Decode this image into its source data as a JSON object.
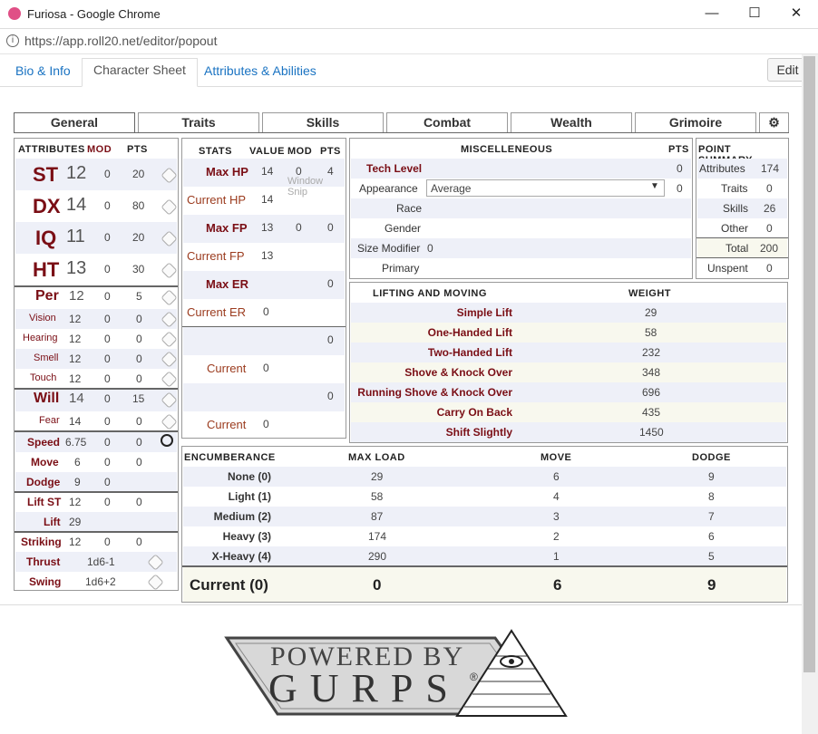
{
  "window": {
    "title": "Furiosa - Google Chrome",
    "minimize": "—",
    "maximize": "☐",
    "close": "✕"
  },
  "url": "https://app.roll20.net/editor/popout",
  "page_tabs": [
    {
      "label": "Bio & Info"
    },
    {
      "label": "Character Sheet"
    },
    {
      "label": "Attributes & Abilities"
    }
  ],
  "edit_label": "Edit",
  "sheet_tabs": [
    "General",
    "Traits",
    "Skills",
    "Combat",
    "Wealth",
    "Grimoire"
  ],
  "attributes": {
    "header": {
      "a": "ATTRIBUTES",
      "m": "MOD",
      "p": "PTS"
    },
    "main": [
      {
        "n": "ST",
        "v": "12",
        "m": "0",
        "p": "20"
      },
      {
        "n": "DX",
        "v": "14",
        "m": "0",
        "p": "80"
      },
      {
        "n": "IQ",
        "v": "11",
        "m": "0",
        "p": "20"
      },
      {
        "n": "HT",
        "v": "13",
        "m": "0",
        "p": "30"
      }
    ],
    "per": {
      "n": "Per",
      "v": "12",
      "m": "0",
      "p": "5"
    },
    "senses": [
      {
        "n": "Vision",
        "v": "12",
        "m": "0"
      },
      {
        "n": "Hearing",
        "v": "12",
        "m": "0"
      },
      {
        "n": "Smell",
        "v": "12",
        "m": "0"
      },
      {
        "n": "Touch",
        "v": "12",
        "m": "0"
      }
    ],
    "will": {
      "n": "Will",
      "v": "14",
      "m": "0",
      "p": "15"
    },
    "fear": {
      "n": "Fear",
      "v": "14",
      "m": "0",
      "p": "0"
    },
    "speed": {
      "n": "Speed",
      "v": "6.75",
      "m": "0",
      "p": "0"
    },
    "move": {
      "n": "Move",
      "v": "6",
      "m": "0",
      "p": "0"
    },
    "dodge": {
      "n": "Dodge",
      "v": "9",
      "m": "0"
    },
    "liftst": {
      "n": "Lift ST",
      "v": "12",
      "m": "0",
      "p": "0"
    },
    "lift": {
      "n": "Lift",
      "v": "29"
    },
    "striking": {
      "n": "Striking",
      "v": "12",
      "m": "0",
      "p": "0"
    },
    "thrust": {
      "n": "Thrust",
      "v": "1d6-1"
    },
    "swing": {
      "n": "Swing",
      "v": "1d6+2"
    }
  },
  "stats": {
    "header": {
      "s": "STATS",
      "v": "VALUE",
      "m": "MOD",
      "p": "PTS"
    },
    "rows": [
      {
        "n": "Max HP",
        "v": "14",
        "m": "0",
        "p": "4"
      },
      {
        "n": "Current HP",
        "v": "14"
      },
      {
        "n": "Max FP",
        "v": "13",
        "m": "0",
        "p": "0"
      },
      {
        "n": "Current FP",
        "v": "13"
      },
      {
        "n": "Max ER",
        "p": "0"
      },
      {
        "n": "Current ER",
        "v": "0"
      }
    ],
    "extra": [
      {
        "p": "0"
      },
      {
        "n": "Current",
        "v": "0"
      },
      {
        "p": "0"
      },
      {
        "n": "Current",
        "v": "0"
      }
    ],
    "overlay": "Window Snip"
  },
  "misc": {
    "header": "MISCELLENEOUS",
    "pts": "PTS",
    "tech_level": {
      "n": "Tech Level",
      "p": "0"
    },
    "appearance": {
      "n": "Appearance",
      "value": "Average",
      "p": "0"
    },
    "race": "Race",
    "gender": "Gender",
    "size": {
      "n": "Size Modifier",
      "v": "0"
    },
    "primary": "Primary"
  },
  "summary": {
    "header": "POINT SUMMARY",
    "rows": [
      {
        "n": "Attributes",
        "v": "174"
      },
      {
        "n": "Traits",
        "v": "0"
      },
      {
        "n": "Skills",
        "v": "26"
      },
      {
        "n": "Other",
        "v": "0"
      }
    ],
    "total": {
      "n": "Total",
      "v": "200"
    },
    "unspent": {
      "n": "Unspent",
      "v": "0"
    }
  },
  "lifting": {
    "header": "LIFTING AND MOVING",
    "weight": "WEIGHT",
    "rows": [
      {
        "n": "Simple Lift",
        "v": "29"
      },
      {
        "n": "One-Handed Lift",
        "v": "58"
      },
      {
        "n": "Two-Handed Lift",
        "v": "232"
      },
      {
        "n": "Shove & Knock Over",
        "v": "348"
      },
      {
        "n": "Running Shove & Knock Over",
        "v": "696"
      },
      {
        "n": "Carry On Back",
        "v": "435"
      },
      {
        "n": "Shift Slightly",
        "v": "1450"
      }
    ]
  },
  "enc": {
    "header": {
      "e": "ENCUMBERANCE",
      "l": "MAX LOAD",
      "m": "MOVE",
      "d": "DODGE"
    },
    "rows": [
      {
        "n": "None (0)",
        "l": "29",
        "m": "6",
        "d": "9"
      },
      {
        "n": "Light (1)",
        "l": "58",
        "m": "4",
        "d": "8"
      },
      {
        "n": "Medium (2)",
        "l": "87",
        "m": "3",
        "d": "7"
      },
      {
        "n": "Heavy (3)",
        "l": "174",
        "m": "2",
        "d": "6"
      },
      {
        "n": "X-Heavy (4)",
        "l": "290",
        "m": "1",
        "d": "5"
      }
    ],
    "current": {
      "n": "Current (0)",
      "l": "0",
      "m": "6",
      "d": "9"
    }
  },
  "logo": {
    "line1": "POWERED BY",
    "line2": "GURPS",
    "reg": "®"
  }
}
